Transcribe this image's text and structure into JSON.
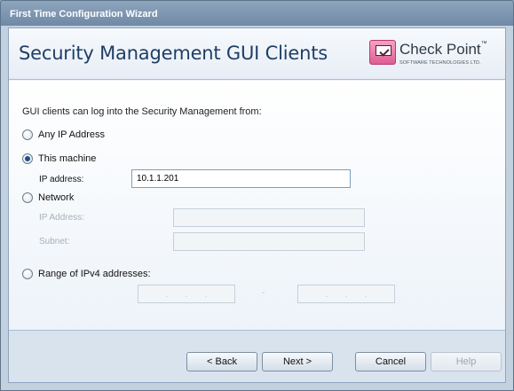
{
  "window": {
    "title": "First Time Configuration Wizard"
  },
  "header": {
    "title": "Security Management GUI Clients"
  },
  "logo": {
    "name": "Check Point",
    "trademark": "™",
    "subtitle": "SOFTWARE TECHNOLOGIES LTD."
  },
  "content": {
    "intro": "GUI clients can log into the Security Management from:",
    "options": {
      "any_ip": {
        "label": "Any IP Address",
        "checked": false
      },
      "this_machine": {
        "label": "This machine",
        "checked": true,
        "ip_label": "IP address:",
        "ip_value": "10.1.1.201"
      },
      "network": {
        "label": "Network",
        "checked": false,
        "ip_label": "IP Address:",
        "subnet_label": "Subnet:"
      },
      "range": {
        "label": "Range of IPv4 addresses:",
        "checked": false,
        "separator": "-"
      }
    }
  },
  "buttons": {
    "back": "< Back",
    "next": "Next >",
    "cancel": "Cancel",
    "help": "Help"
  },
  "icons": {
    "logo": "check-point-logo-icon",
    "radio": "radio-button"
  }
}
